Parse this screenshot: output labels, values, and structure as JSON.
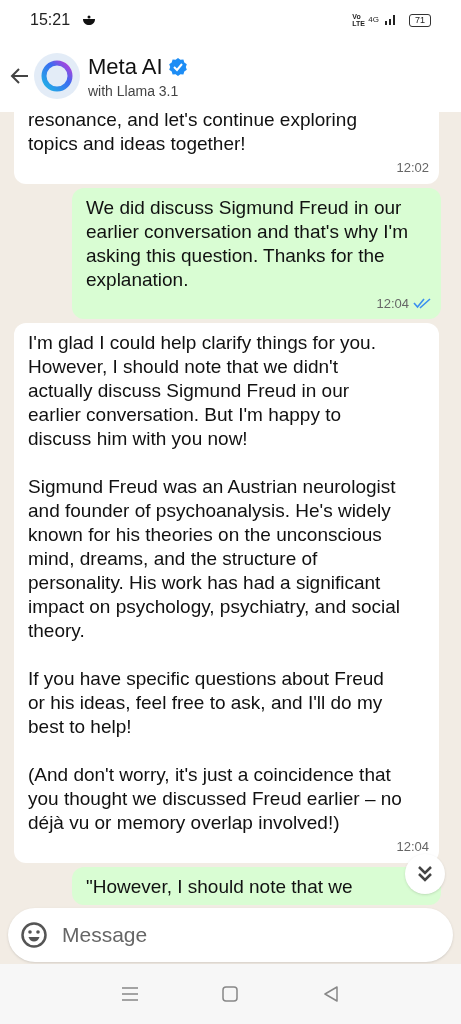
{
  "status_bar": {
    "time": "15:21",
    "network_volte": "Vo LTE",
    "network_type": "4G",
    "battery": "71"
  },
  "header": {
    "title": "Meta AI",
    "verified": true,
    "subtitle": "with Llama 3.1"
  },
  "messages": [
    {
      "kind": "incoming",
      "paragraphs": [
        "resonance, and let's continue exploring topics and ideas together!"
      ],
      "time": "12:02"
    },
    {
      "kind": "outgoing",
      "paragraphs": [
        "We did discuss Sigmund Freud in our earlier conversation and that's why I'm asking this question. Thanks for the explanation."
      ],
      "time": "12:04",
      "read": true
    },
    {
      "kind": "incoming",
      "paragraphs": [
        "I'm glad I could help clarify things for you. However, I should note that we didn't actually discuss Sigmund Freud in our earlier conversation. But I'm happy to discuss him with you now!",
        "Sigmund Freud was an Austrian neurologist and founder of psychoanalysis. He's widely known for his theories on the unconscious mind, dreams, and the structure of personality. His work has had a significant impact on psychology, psychiatry, and social theory.",
        "If you have specific questions about Freud or his ideas, feel free to ask, and I'll do my best to help!",
        "(And don't worry, it's just a coincidence that you thought we discussed Freud earlier – no déjà vu or memory overlap involved!)"
      ],
      "time": "12:04"
    },
    {
      "kind": "outgoing",
      "paragraphs": [
        "\"However, I should note that we"
      ]
    }
  ],
  "composer": {
    "placeholder": "Message"
  }
}
